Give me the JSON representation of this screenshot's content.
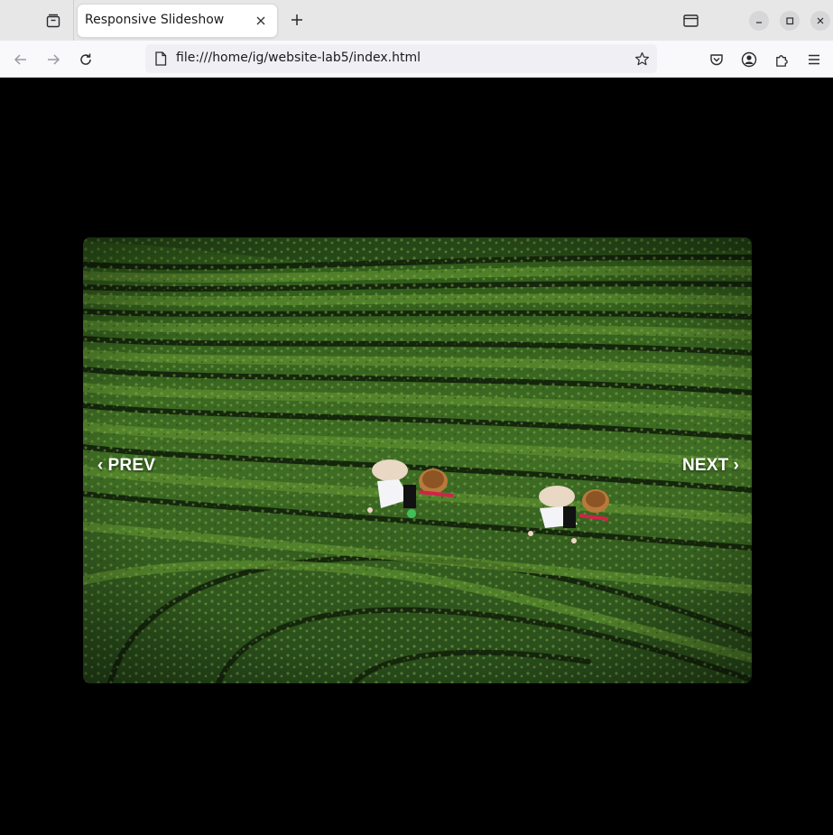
{
  "browser": {
    "tab_title": "Responsive Slideshow",
    "url": "file:///home/ig/website-lab5/index.html"
  },
  "slideshow": {
    "prev_label": "PREV",
    "next_label": "NEXT",
    "prev_chevron": "‹",
    "next_chevron": "›",
    "current_slide": {
      "subject": "aerial view of tea plantation rows with two workers in conical hats",
      "colors": {
        "field_dark": "#1e3a12",
        "field_mid": "#3f6e24",
        "field_light": "#7fa84a"
      }
    }
  },
  "icons": [
    "tab-list-icon",
    "close-icon",
    "plus-icon",
    "overview-icon",
    "minimize-icon",
    "maximize-icon",
    "window-close-icon",
    "back-icon",
    "forward-icon",
    "reload-icon",
    "page-icon",
    "bookmark-star-icon",
    "pocket-icon",
    "account-icon",
    "extensions-icon",
    "menu-icon"
  ]
}
